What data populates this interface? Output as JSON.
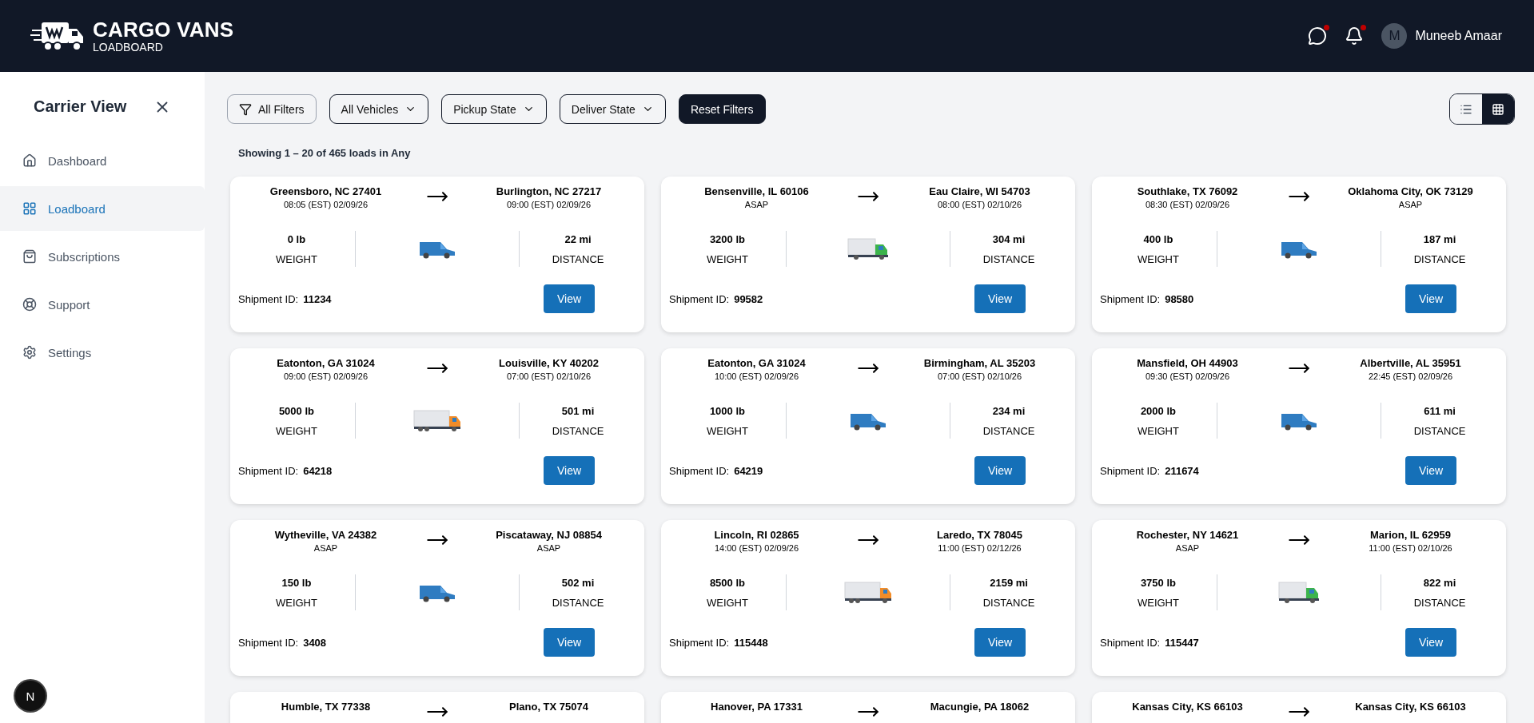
{
  "header": {
    "logo_title": "CARGO VANS",
    "logo_subtitle": "LOADBOARD",
    "messages_dot": true,
    "notifications_dot": true,
    "user": {
      "initial": "M",
      "name": "Muneeb Amaar"
    }
  },
  "sidebar": {
    "title": "Carrier View",
    "items": [
      {
        "label": "Dashboard",
        "selected": false
      },
      {
        "label": "Loadboard",
        "selected": true
      },
      {
        "label": "Subscriptions",
        "selected": false
      },
      {
        "label": "Support",
        "selected": false
      },
      {
        "label": "Settings",
        "selected": false
      }
    ]
  },
  "filters": {
    "all_filters": "All Filters",
    "dropdowns": [
      "All Vehicles",
      "Pickup State",
      "Deliver State"
    ],
    "reset": "Reset Filters",
    "view_modes": [
      {
        "kind": "list",
        "selected": false
      },
      {
        "kind": "grid",
        "selected": true
      }
    ]
  },
  "summary": "Showing 1 – 20 of 465 loads in Any",
  "loads": [
    {
      "from": "Greensboro, NC 27401",
      "from_time": "08:05 (EST) 02/09/26",
      "to": "Burlington, NC 27217",
      "to_time": "09:00 (EST) 02/09/26",
      "weight": "0 lb",
      "weight_label": "WEIGHT",
      "kind": "van",
      "distance": "22 mi",
      "distance_label": "DISTANCE",
      "id_label": "Shipment ID:",
      "id": "11234",
      "action": "View"
    },
    {
      "from": "Bensenville, IL 60106",
      "from_time": "ASAP",
      "to": "Eau Claire, WI 54703",
      "to_time": "08:00 (EST) 02/10/26",
      "weight": "3200 lb",
      "weight_label": "WEIGHT",
      "kind": "box_truck",
      "distance": "304 mi",
      "distance_label": "DISTANCE",
      "id_label": "Shipment ID:",
      "id": "99582",
      "action": "View"
    },
    {
      "from": "Southlake, TX 76092",
      "from_time": "08:30 (EST) 02/09/26",
      "to": "Oklahoma City, OK 73129",
      "to_time": "ASAP",
      "weight": "400 lb",
      "weight_label": "WEIGHT",
      "kind": "van",
      "distance": "187 mi",
      "distance_label": "DISTANCE",
      "id_label": "Shipment ID:",
      "id": "98580",
      "action": "View"
    },
    {
      "from": "Eatonton, GA 31024",
      "from_time": "09:00 (EST) 02/09/26",
      "to": "Louisville, KY 40202",
      "to_time": "07:00 (EST) 02/10/26",
      "weight": "5000 lb",
      "weight_label": "WEIGHT",
      "kind": "large_truck",
      "distance": "501 mi",
      "distance_label": "DISTANCE",
      "id_label": "Shipment ID:",
      "id": "64218",
      "action": "View"
    },
    {
      "from": "Eatonton, GA 31024",
      "from_time": "10:00 (EST) 02/09/26",
      "to": "Birmingham, AL 35203",
      "to_time": "07:00 (EST) 02/10/26",
      "weight": "1000 lb",
      "weight_label": "WEIGHT",
      "kind": "van",
      "distance": "234 mi",
      "distance_label": "DISTANCE",
      "id_label": "Shipment ID:",
      "id": "64219",
      "action": "View"
    },
    {
      "from": "Mansfield, OH 44903",
      "from_time": "09:30 (EST) 02/09/26",
      "to": "Albertville, AL 35951",
      "to_time": "22:45 (EST) 02/09/26",
      "weight": "2000 lb",
      "weight_label": "WEIGHT",
      "kind": "van",
      "distance": "611 mi",
      "distance_label": "DISTANCE",
      "id_label": "Shipment ID:",
      "id": "211674",
      "action": "View"
    },
    {
      "from": "Wytheville, VA 24382",
      "from_time": "ASAP",
      "to": "Piscataway, NJ 08854",
      "to_time": "ASAP",
      "weight": "150 lb",
      "weight_label": "WEIGHT",
      "kind": "van",
      "distance": "502 mi",
      "distance_label": "DISTANCE",
      "id_label": "Shipment ID:",
      "id": "3408",
      "action": "View"
    },
    {
      "from": "Lincoln, RI 02865",
      "from_time": "14:00 (EST) 02/09/26",
      "to": "Laredo, TX 78045",
      "to_time": "11:00 (EST) 02/12/26",
      "weight": "8500 lb",
      "weight_label": "WEIGHT",
      "kind": "large_truck",
      "distance": "2159 mi",
      "distance_label": "DISTANCE",
      "id_label": "Shipment ID:",
      "id": "115448",
      "action": "View"
    },
    {
      "from": "Rochester, NY 14621",
      "from_time": "ASAP",
      "to": "Marion, IL 62959",
      "to_time": "11:00 (EST) 02/10/26",
      "weight": "3750 lb",
      "weight_label": "WEIGHT",
      "kind": "box_truck",
      "distance": "822 mi",
      "distance_label": "DISTANCE",
      "id_label": "Shipment ID:",
      "id": "115447",
      "action": "View"
    },
    {
      "from": "Humble, TX 77338",
      "to": "Plano, TX 75074"
    },
    {
      "from": "Hanover, PA 17331",
      "to": "Macungie, PA 18062"
    },
    {
      "from": "Kansas City, KS 66103",
      "to": "Kansas City, KS 66103"
    }
  ],
  "dev_badge": "N"
}
